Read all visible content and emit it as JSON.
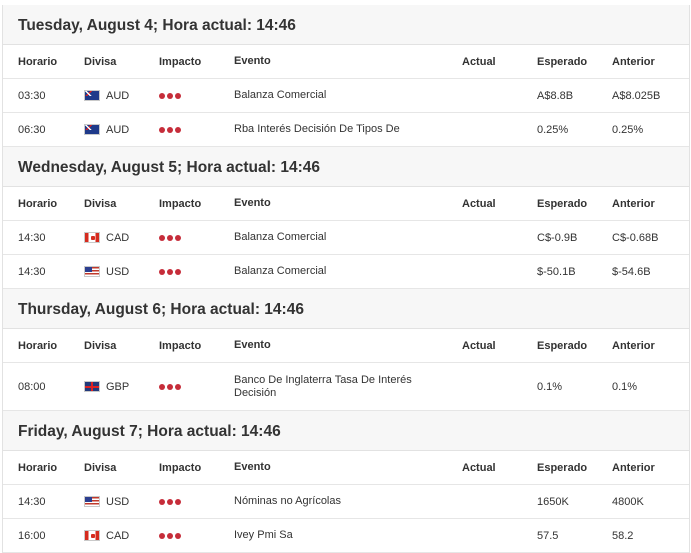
{
  "colors": {
    "impact_high": "#c62d3a"
  },
  "headers": {
    "time": "Horario",
    "currency": "Divisa",
    "impact": "Impacto",
    "event": "Evento",
    "actual": "Actual",
    "expected": "Esperado",
    "previous": "Anterior"
  },
  "sections": [
    {
      "title": "Tuesday, August 4; Hora actual: 14:46",
      "rows": [
        {
          "time": "03:30",
          "currency": "AUD",
          "flag_icon": "australia-flag-icon",
          "impact": "high",
          "event": "Balanza Comercial",
          "actual": "",
          "expected": "A$8.8B",
          "previous": "A$8.025B"
        },
        {
          "time": "06:30",
          "currency": "AUD",
          "flag_icon": "australia-flag-icon",
          "impact": "high",
          "event": "Rba Interés Decisión De Tipos De",
          "actual": "",
          "expected": "0.25%",
          "previous": "0.25%"
        }
      ]
    },
    {
      "title": "Wednesday, August 5; Hora actual: 14:46",
      "rows": [
        {
          "time": "14:30",
          "currency": "CAD",
          "flag_icon": "canada-flag-icon",
          "impact": "high",
          "event": "Balanza Comercial",
          "actual": "",
          "expected": "C$-0.9B",
          "previous": "C$-0.68B"
        },
        {
          "time": "14:30",
          "currency": "USD",
          "flag_icon": "usa-flag-icon",
          "impact": "high",
          "event": "Balanza Comercial",
          "actual": "",
          "expected": "$-50.1B",
          "previous": "$-54.6B"
        }
      ]
    },
    {
      "title": "Thursday, August 6; Hora actual: 14:46",
      "rows": [
        {
          "time": "08:00",
          "currency": "GBP",
          "flag_icon": "uk-flag-icon",
          "impact": "high",
          "event": "Banco De Inglaterra Tasa De Interés Decisión",
          "actual": "",
          "expected": "0.1%",
          "previous": "0.1%"
        }
      ]
    },
    {
      "title": "Friday, August 7; Hora actual: 14:46",
      "rows": [
        {
          "time": "14:30",
          "currency": "USD",
          "flag_icon": "usa-flag-icon",
          "impact": "high",
          "event": "Nóminas no Agrícolas",
          "actual": "",
          "expected": "1650K",
          "previous": "4800K"
        },
        {
          "time": "16:00",
          "currency": "CAD",
          "flag_icon": "canada-flag-icon",
          "impact": "high",
          "event": "Ivey Pmi Sa",
          "actual": "",
          "expected": "57.5",
          "previous": "58.2"
        }
      ]
    }
  ]
}
